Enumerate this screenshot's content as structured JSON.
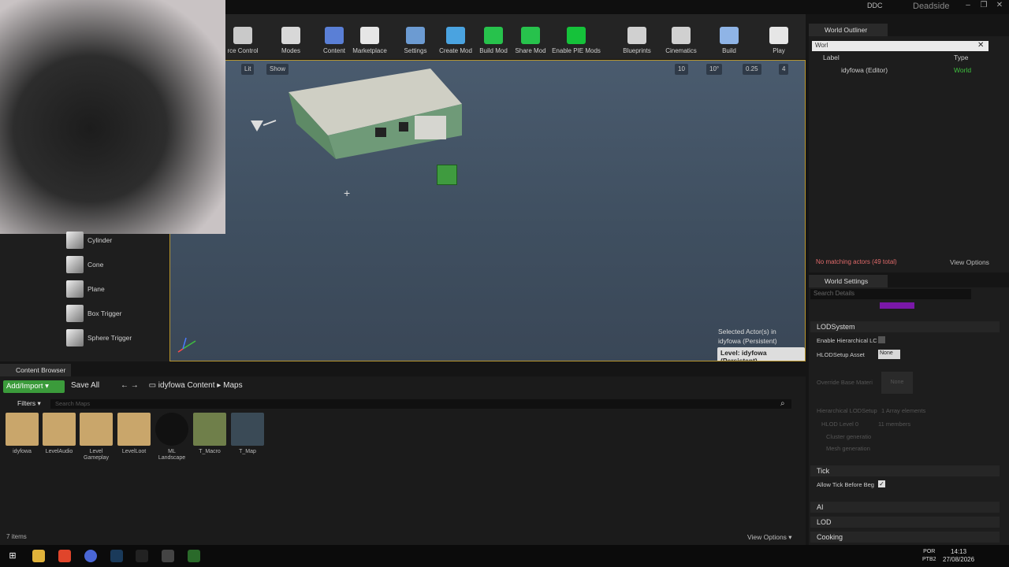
{
  "titlebar": {
    "ddc": "DDC",
    "project": "Deadside",
    "minimize": "–",
    "maximize": "❐",
    "close": "✕"
  },
  "toolbar": {
    "items": [
      {
        "label": "rce Control",
        "color": "#c9c9c9"
      },
      {
        "label": "Modes",
        "color": "#d8d8d8"
      },
      {
        "label": "Content",
        "color": "#5a7fd6"
      },
      {
        "label": "Marketplace",
        "color": "#e6e6e6"
      },
      {
        "label": "Settings",
        "color": "#6c9bd2"
      },
      {
        "label": "Create Mod",
        "color": "#4aa3e0"
      },
      {
        "label": "Build Mod",
        "color": "#27c24c"
      },
      {
        "label": "Share Mod",
        "color": "#27c24c"
      },
      {
        "label": "Enable PIE Mods",
        "color": "#15c23a"
      },
      {
        "label": "Blueprints",
        "color": "#d0d0d0"
      },
      {
        "label": "Cinematics",
        "color": "#d0d0d0"
      },
      {
        "label": "Build",
        "color": "#8fb4e6"
      },
      {
        "label": "Play",
        "color": "#e6e6e6"
      }
    ]
  },
  "viewport": {
    "buttons": [
      "Lit",
      "Show"
    ],
    "right_readouts": [
      "10",
      "10°",
      "0.25",
      "4"
    ],
    "selected_info_1": "Selected Actor(s) in",
    "selected_info_2": "idyfowa (Persistent)",
    "level_badge": "Level: idyfowa (Persistent)"
  },
  "place_panel": {
    "items": [
      "Cylinder",
      "Cone",
      "Plane",
      "Box Trigger",
      "Sphere Trigger"
    ]
  },
  "outliner": {
    "tab": "World Outliner",
    "search_value": "Worl",
    "col_label": "Label",
    "col_type": "Type",
    "row_label": "idyfowa (Editor)",
    "row_type": "World",
    "status": "No matching actors (49 total)",
    "view_options": "View Options"
  },
  "details": {
    "tab": "World Settings",
    "search_placeholder": "Search Details",
    "lod_section": "LODSystem",
    "enable_hlod": "Enable Hierarchical LC",
    "hlod_setup": "HLODSetup Asset",
    "hlod_none": "None",
    "override": "Override Base Materi",
    "override_none": "None",
    "hierarchical": "Hierarchical LODSetup",
    "hierarchical_val": "1 Array elements",
    "hlod_level": "HLOD Level 0",
    "hlod_level_val": "11 members",
    "cluster": "Cluster generatio",
    "mesh": "Mesh generation",
    "tick_section": "Tick",
    "allow_tick": "Allow Tick Before Beg",
    "ai": "AI",
    "lod": "LOD",
    "cooking": "Cooking"
  },
  "content_browser": {
    "tab": "Content Browser",
    "add_import": "Add/Import ▾",
    "save_all": "Save All",
    "crumb_root": "idyfowa Content",
    "crumb_child": "Maps",
    "filters": "Filters ▾",
    "search_placeholder": "Search Maps",
    "assets": [
      {
        "name": "idyfowa",
        "color": "#c9a66b"
      },
      {
        "name": "LevelAudio",
        "color": "#c9a66b"
      },
      {
        "name": "Level Gameplay",
        "color": "#c9a66b"
      },
      {
        "name": "LevelLoot",
        "color": "#c9a66b"
      },
      {
        "name": "ML Landscape",
        "color": "#111111"
      },
      {
        "name": "T_Macro",
        "color": "#6f7f4a"
      },
      {
        "name": "T_Map",
        "color": "#3a4a56"
      }
    ],
    "items_count": "7 items",
    "view_options": "View Options ▾"
  },
  "taskbar": {
    "lang_1": "POR",
    "lang_2": "PTB2",
    "time": "14:13",
    "date": "27/08/2026"
  }
}
